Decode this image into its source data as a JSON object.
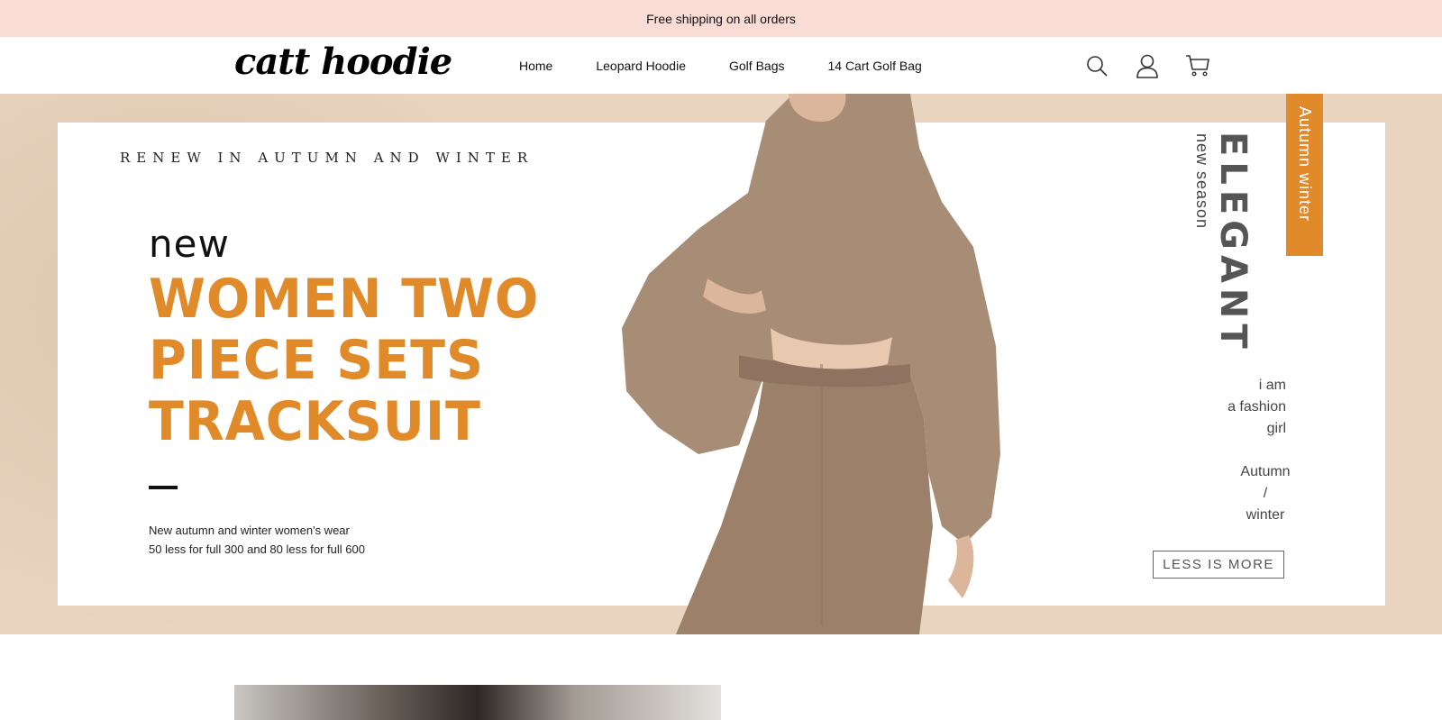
{
  "announcement": "Free shipping on all orders",
  "logo": "catt hoodie",
  "nav": [
    "Home",
    "Leopard Hoodie",
    "Golf Bags",
    "14 Cart Golf Bag"
  ],
  "header_icons": [
    "search-icon",
    "account-icon",
    "cart-icon"
  ],
  "hero": {
    "kicker": "RENEW IN AUTUMN AND WINTER",
    "new_tag": "new",
    "headline": [
      "WOMEN TWO",
      "PIECE SETS",
      "TRACKSUIT"
    ],
    "desc": [
      "New autumn and winter women's wear",
      "50 less for full 300 and 80 less for full 600"
    ],
    "elegant": "ELEGANT",
    "new_season": "new season",
    "autumn_tag": "Autumn winter",
    "side_lines_1": [
      "i am",
      "a fashion",
      "girl"
    ],
    "side_lines_2": [
      "Autumn",
      "/",
      "winter"
    ],
    "less_is_more": "LESS IS MORE"
  },
  "colors": {
    "announce_bg": "#f9dcd6",
    "accent": "#e08a2a",
    "hero_bg": "#e8d4bf",
    "hoodie": "#a88d76"
  }
}
